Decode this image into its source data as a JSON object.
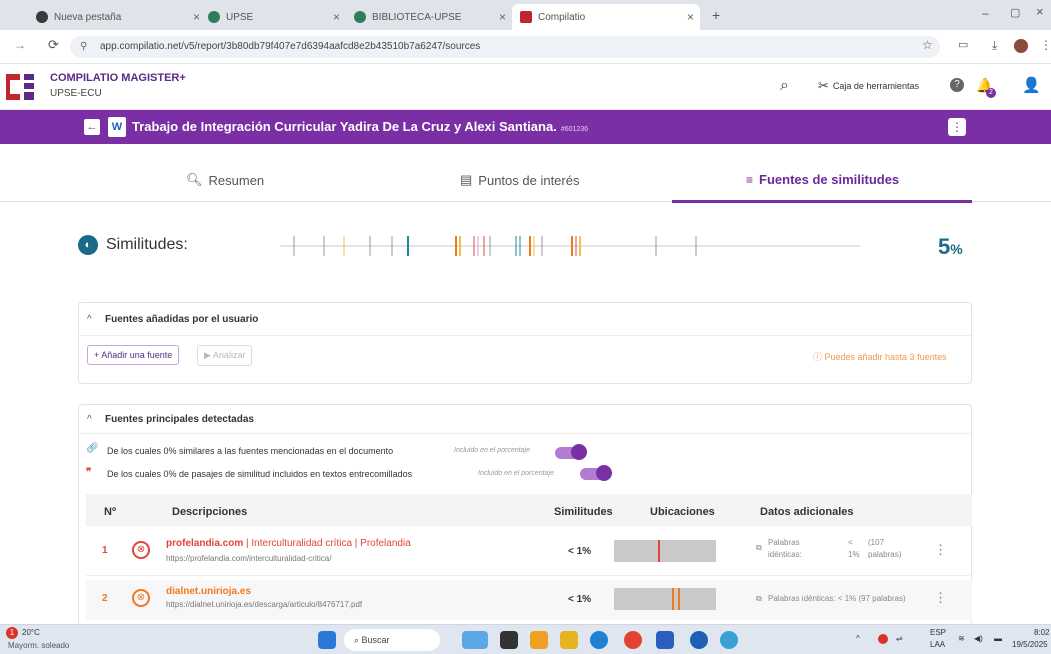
{
  "browser": {
    "tabs": [
      {
        "label": "Nueva pestaña",
        "icon": "globe-icon",
        "color": "#3a3a3a"
      },
      {
        "label": "UPSE",
        "icon": "globe-icon",
        "color": "#2e7d5a"
      },
      {
        "label": "BIBLIOTECA-UPSE",
        "icon": "globe-icon",
        "color": "#2e7d5a"
      },
      {
        "label": "Compilatio",
        "icon": "compilatio-icon",
        "color": "#c0262d"
      }
    ],
    "new_tab": "+",
    "url": "app.compilatio.net/v5/report/3b80db79f407e7d6394aafcd8e2b43510b7a6247/sources"
  },
  "app": {
    "brand_title": "COMPILATIO MAGISTER+",
    "brand_sub": "UPSE-ECU",
    "toolbox_label": "Caja de herramientas",
    "notif_count": "2"
  },
  "document": {
    "title": "Trabajo de Integración Curricular Yadira De La Cruz y Alexi Santiana.",
    "id": "#601236",
    "file_badge": "W"
  },
  "nav": {
    "tabs": [
      {
        "label": "Resumen"
      },
      {
        "label": "Puntos de interés"
      },
      {
        "label": "Fuentes de similitudes"
      }
    ]
  },
  "similarity": {
    "label": "Similitudes:",
    "percent": "5",
    "unit": "%"
  },
  "user_sources": {
    "title": "Fuentes añadidas por el usuario",
    "add_button": "+ Añadir una fuente",
    "analyze_button": "▶ Analizar",
    "hint": "ⓘ Puedes añadir hasta 3 fuentes"
  },
  "main_sources": {
    "title": "Fuentes principales detectadas",
    "filter1": "De los cuales 0% similares a las fuentes mencionadas en el documento",
    "filter1_note": "Incluido en el porcentaje",
    "filter2": "De los cuales 0% de pasajes de similitud incluidos en textos entrecomillados",
    "filter2_note": "Incluido en el porcentaje",
    "headers": {
      "num": "Nº",
      "desc": "Descripciones",
      "sim": "Similitudes",
      "loc": "Ubicaciones",
      "extra": "Datos adicionales"
    },
    "rows": [
      {
        "num": "1",
        "name": "profelandia.com",
        "title": " | Interculturalidad crítica | Profelandia",
        "url": "https://profelandia.com/interculturalidad-critica/",
        "sim": "< 1%",
        "extra_a": "Palabras",
        "extra_b": "idénticas:",
        "extra_c": "<",
        "extra_d": "1%",
        "extra_e": "(107",
        "extra_f": "palabras)",
        "color": "#e0453a"
      },
      {
        "num": "2",
        "name": "dialnet.unirioja.es",
        "title": "",
        "url": "https://dialnet.unirioja.es/descarga/articulo/8476717.pdf",
        "sim": "< 1%",
        "extra_line": "Palabras idénticas: < 1% (97 palabras)",
        "color": "#ee7a1f"
      }
    ]
  },
  "taskbar": {
    "weather_temp": "20°C",
    "weather_desc": "Mayorm. soleado",
    "search_placeholder": "Buscar",
    "lang1": "ESP",
    "lang2": "LAA",
    "time": "8:02",
    "date": "19/5/2025"
  }
}
